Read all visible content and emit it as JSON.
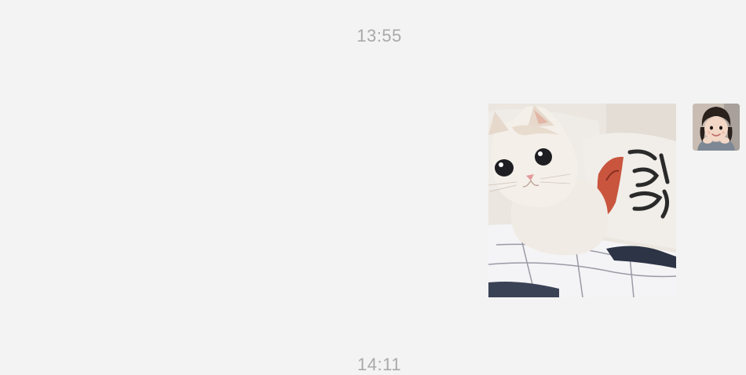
{
  "chat": {
    "timestamps": [
      "13:55",
      "14:11"
    ],
    "messages": [
      {
        "direction": "outgoing",
        "kind": "image",
        "image_subject": "cat-photo"
      }
    ]
  },
  "colors": {
    "background": "#f3f3f3",
    "timestamp_text": "#a9a9a9"
  }
}
